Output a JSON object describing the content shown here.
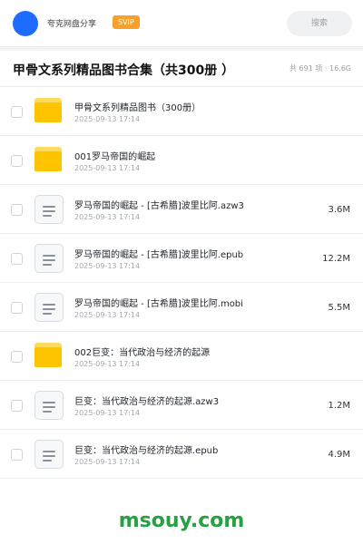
{
  "topbar": {
    "share_label": "夸克网盘分享",
    "badge": "SVIP",
    "search_placeholder": "搜索"
  },
  "header": {
    "title": "甲骨文系列精品图书合集（共300册 ）",
    "meta": "共 691 项 · 16.6G"
  },
  "items": [
    {
      "type": "folder",
      "name": "甲骨文系列精品图书（300册）",
      "date": "2025-09-13 17:14",
      "size": ""
    },
    {
      "type": "folder",
      "name": "001罗马帝国的崛起",
      "date": "2025-09-13 17:14",
      "size": ""
    },
    {
      "type": "file",
      "name": "罗马帝国的崛起 - [古希腊]波里比阿.azw3",
      "date": "2025-09-13 17:14",
      "size": "3.6M"
    },
    {
      "type": "file",
      "name": "罗马帝国的崛起 - [古希腊]波里比阿.epub",
      "date": "2025-09-13 17:14",
      "size": "12.2M"
    },
    {
      "type": "file",
      "name": "罗马帝国的崛起 - [古希腊]波里比阿.mobi",
      "date": "2025-09-13 17:14",
      "size": "5.5M"
    },
    {
      "type": "folder",
      "name": "002巨变：当代政治与经济的起源",
      "date": "2025-09-13 17:14",
      "size": ""
    },
    {
      "type": "file",
      "name": "巨变：当代政治与经济的起源.azw3",
      "date": "2025-09-13 17:14",
      "size": "1.2M"
    },
    {
      "type": "file",
      "name": "巨变：当代政治与经济的起源.epub",
      "date": "2025-09-13 17:14",
      "size": "4.9M"
    }
  ],
  "watermark": "msouy.com"
}
